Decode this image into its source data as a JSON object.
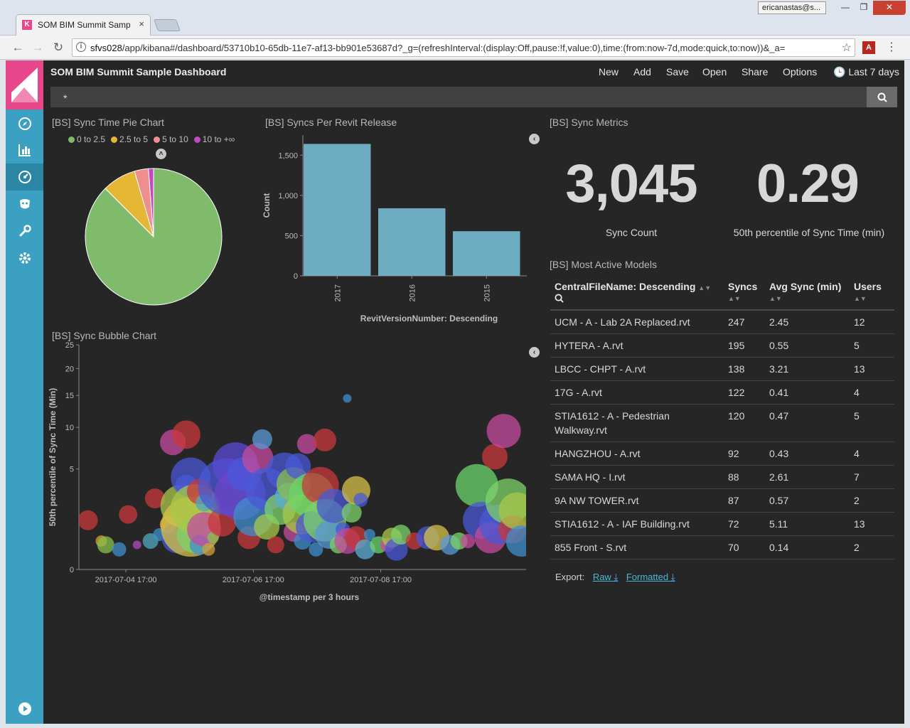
{
  "browser": {
    "tab_title": "SOM BIM Summit Samp",
    "tab_close": "×",
    "user_chip": "ericanastas@s...",
    "window_controls": {
      "minimize": "—",
      "maximize": "❐",
      "close": "✕"
    },
    "url_host": "sfvs028",
    "url_path": "/app/kibana#/dashboard/53710b10-65db-11e7-af13-bb901e53687d?_g=(refreshInterval:(display:Off,pause:!f,value:0),time:(from:now-7d,mode:quick,to:now))&_a="
  },
  "kibana": {
    "dashboard_title": "SOM BIM Summit Sample Dashboard",
    "nav": {
      "new": "New",
      "add": "Add",
      "save": "Save",
      "open": "Open",
      "share": "Share",
      "options": "Options",
      "time": "Last 7 days"
    },
    "query": "*",
    "sidebar_icons": [
      "discover-icon",
      "visualize-icon",
      "dashboard-icon",
      "timelion-icon",
      "dev-tools-icon",
      "management-icon",
      "play-icon"
    ]
  },
  "panels": {
    "pie_title": "[BS] Sync Time Pie Chart",
    "bar_title": "[BS] Syncs Per Revit Release",
    "metrics_title": "[BS] Sync Metrics",
    "bubble_title": "[BS] Sync Bubble Chart",
    "models_title": "[BS] Most Active Models"
  },
  "metrics": {
    "sync_count": "3,045",
    "sync_count_label": "Sync Count",
    "p50_sync_time": "0.29",
    "p50_sync_time_label": "50th percentile of Sync Time (min)"
  },
  "pie_legend": [
    {
      "label": "0 to 2.5",
      "color": "#7fbb6b"
    },
    {
      "label": "2.5 to 5",
      "color": "#e6b735"
    },
    {
      "label": "5 to 10",
      "color": "#ef8e8e"
    },
    {
      "label": "10 to +∞",
      "color": "#c14bbd"
    }
  ],
  "chart_data": [
    {
      "type": "pie",
      "title": "[BS] Sync Time Pie Chart",
      "categories": [
        "0 to 2.5",
        "2.5 to 5",
        "5 to 10",
        "10 to +∞"
      ],
      "values": [
        87.5,
        8.0,
        3.3,
        1.2
      ],
      "colors": [
        "#7fbb6b",
        "#e6b735",
        "#ef8e8e",
        "#c14bbd"
      ],
      "legend": "top"
    },
    {
      "type": "bar",
      "title": "[BS] Syncs Per Revit Release",
      "categories": [
        "2017",
        "2016",
        "2015"
      ],
      "values": [
        1640,
        840,
        555
      ],
      "xlabel": "RevitVersionNumber: Descending",
      "ylabel": "Count",
      "ylim": [
        0,
        1750
      ],
      "yticks": [
        0,
        500,
        1000,
        1500
      ],
      "ytick_labels": [
        "0",
        "500",
        "1,000",
        "1,500"
      ],
      "color": "#6eadc1"
    },
    {
      "type": "scatter",
      "title": "[BS] Sync Bubble Chart",
      "xlabel": "@timestamp per 3 hours",
      "ylabel": "50th percentile of Sync Time (Min)",
      "xtick_labels": [
        "2017-07-04 17:00",
        "2017-07-06 17:00",
        "2017-07-08 17:00"
      ],
      "ytick_labels": [
        "0",
        "5",
        "10",
        "15",
        "20",
        "25"
      ],
      "ylim": [
        0,
        25
      ],
      "y_scale": "sqrt",
      "x": [
        0.02,
        0.05,
        0.06,
        0.09,
        0.11,
        0.13,
        0.16,
        0.17,
        0.18,
        0.2,
        0.21,
        0.22,
        0.23,
        0.24,
        0.24,
        0.25,
        0.25,
        0.26,
        0.26,
        0.27,
        0.27,
        0.28,
        0.28,
        0.29,
        0.3,
        0.32,
        0.33,
        0.35,
        0.36,
        0.37,
        0.38,
        0.39,
        0.4,
        0.41,
        0.42,
        0.42,
        0.44,
        0.45,
        0.46,
        0.47,
        0.48,
        0.48,
        0.49,
        0.5,
        0.5,
        0.51,
        0.52,
        0.52,
        0.53,
        0.54,
        0.55,
        0.55,
        0.56,
        0.57,
        0.58,
        0.59,
        0.6,
        0.6,
        0.61,
        0.62,
        0.62,
        0.63,
        0.64,
        0.65,
        0.67,
        0.69,
        0.7,
        0.71,
        0.72,
        0.75,
        0.78,
        0.8,
        0.83,
        0.85,
        0.87,
        0.89,
        0.9,
        0.92,
        0.93,
        0.94,
        0.95,
        0.96,
        0.97,
        0.98,
        0.99
      ],
      "y": [
        1.2,
        0.4,
        0.3,
        0.2,
        1.5,
        0.3,
        0.4,
        2.5,
        0.6,
        1.0,
        8.0,
        0.5,
        2.0,
        3.5,
        9.0,
        0.9,
        4.2,
        0.6,
        1.8,
        3.0,
        0.3,
        0.8,
        2.2,
        0.2,
        0.5,
        1.1,
        3.4,
        5.4,
        2.8,
        4.5,
        0.5,
        1.4,
        6.1,
        8.4,
        0.9,
        3.2,
        0.3,
        1.8,
        4.8,
        2.6,
        0.7,
        3.6,
        5.3,
        0.4,
        1.5,
        7.8,
        2.7,
        0.9,
        0.2,
        3.5,
        1.2,
        8.3,
        0.6,
        2.0,
        0.3,
        0.8,
        14.5,
        0.4,
        1.6,
        3.1,
        0.5,
        2.4,
        0.2,
        0.6,
        0.3,
        0.3,
        0.5,
        0.2,
        0.6,
        0.4,
        0.5,
        0.5,
        0.3,
        0.4,
        0.4,
        3.5,
        1.2,
        0.5,
        6.3,
        1.0,
        9.5,
        2.3,
        0.8,
        1.7,
        0.4
      ],
      "r": [
        14,
        8,
        12,
        10,
        13,
        6,
        11,
        14,
        9,
        12,
        18,
        22,
        30,
        15,
        20,
        42,
        28,
        26,
        35,
        18,
        14,
        24,
        12,
        9,
        8,
        20,
        40,
        32,
        36,
        24,
        16,
        28,
        22,
        14,
        18,
        30,
        12,
        22,
        26,
        20,
        14,
        24,
        18,
        12,
        28,
        14,
        32,
        22,
        10,
        26,
        30,
        16,
        20,
        24,
        12,
        10,
        6,
        18,
        14,
        20,
        16,
        10,
        14,
        8,
        12,
        10,
        14,
        16,
        14,
        12,
        16,
        18,
        14,
        12,
        10,
        30,
        26,
        22,
        18,
        28,
        24,
        32,
        20,
        26,
        22
      ],
      "colors": [
        "#c8383b",
        "#d2a03c",
        "#8ac24a",
        "#3f8fcc",
        "#c8383b",
        "#b04bc0",
        "#4ea8c0",
        "#c8383b",
        "#3f8fcc",
        "#e0a43a",
        "#c64b9f",
        "#4a58d6",
        "#a8c84a",
        "#4a58d6",
        "#c8383b",
        "#d6c14a",
        "#4a58d6",
        "#7ed36a",
        "#a8c84a",
        "#c8383b",
        "#3f8fcc",
        "#c64b9f",
        "#4ea8c0",
        "#d2a03c",
        "#8ac24a",
        "#c8383b",
        "#4a58d6",
        "#5a4ad6",
        "#6b45c9",
        "#4a58d6",
        "#c8383b",
        "#3f8fcc",
        "#c64b9f",
        "#5a9ad6",
        "#a8c84a",
        "#4a58d6",
        "#c8383b",
        "#7ed36a",
        "#4a58d6",
        "#5aaed6",
        "#c64b9f",
        "#8ac24a",
        "#4a58d6",
        "#3f8fcc",
        "#a8c84a",
        "#c64b9f",
        "#6bd66a",
        "#4a58d6",
        "#3f8fcc",
        "#c8383b",
        "#7ed36a",
        "#c8383b",
        "#5a9ad6",
        "#4a58d6",
        "#7ed36a",
        "#4a58d6",
        "#3f8fcc",
        "#c64b9f",
        "#7ed36a",
        "#d6c14a",
        "#c8383b",
        "#4a58d6",
        "#5aaed6",
        "#3f8fcc",
        "#6bd66a",
        "#c64b9f",
        "#a8c84a",
        "#4a58d6",
        "#7ed36a",
        "#c8383b",
        "#4a58d6",
        "#d6c14a",
        "#5a9ad6",
        "#7ed36a",
        "#c64b9f",
        "#6bd66a",
        "#4a58d6",
        "#c64b9f",
        "#c8383b",
        "#4a58d6",
        "#c64b9f",
        "#7ed36a",
        "#c8383b",
        "#a8c84a",
        "#3f8fcc"
      ]
    },
    {
      "type": "table",
      "title": "[BS] Most Active Models",
      "columns": [
        "CentralFileName: Descending",
        "Syncs",
        "Avg Sync (min)",
        "Users"
      ],
      "rows": [
        [
          "UCM - A - Lab 2A Replaced.rvt",
          "247",
          "2.45",
          "12"
        ],
        [
          "HYTERA - A.rvt",
          "195",
          "0.55",
          "5"
        ],
        [
          "LBCC - CHPT - A.rvt",
          "138",
          "3.21",
          "13"
        ],
        [
          "17G - A.rvt",
          "122",
          "0.41",
          "4"
        ],
        [
          "STIA1612 - A - Pedestrian Walkway.rvt",
          "120",
          "0.47",
          "5"
        ],
        [
          "HANGZHOU - A.rvt",
          "92",
          "0.43",
          "4"
        ],
        [
          "SAMA HQ - I.rvt",
          "88",
          "2.61",
          "7"
        ],
        [
          "9A NW TOWER.rvt",
          "87",
          "0.57",
          "2"
        ],
        [
          "STIA1612 - A - IAF Building.rvt",
          "72",
          "5.11",
          "13"
        ],
        [
          "855 Front - S.rvt",
          "70",
          "0.14",
          "2"
        ]
      ]
    }
  ],
  "export": {
    "label": "Export:",
    "raw": "Raw",
    "formatted": "Formatted"
  }
}
